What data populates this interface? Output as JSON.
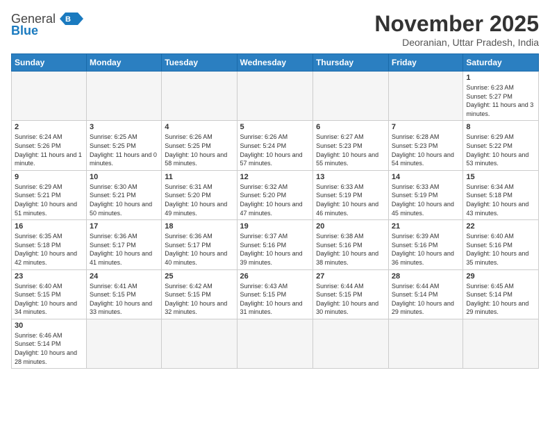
{
  "header": {
    "logo_general": "General",
    "logo_blue": "Blue",
    "month_title": "November 2025",
    "location": "Deoranian, Uttar Pradesh, India"
  },
  "weekdays": [
    "Sunday",
    "Monday",
    "Tuesday",
    "Wednesday",
    "Thursday",
    "Friday",
    "Saturday"
  ],
  "days": [
    {
      "date": "",
      "empty": true
    },
    {
      "date": "",
      "empty": true
    },
    {
      "date": "",
      "empty": true
    },
    {
      "date": "",
      "empty": true
    },
    {
      "date": "",
      "empty": true
    },
    {
      "date": "",
      "empty": true
    },
    {
      "date": "1",
      "sunrise": "Sunrise: 6:23 AM",
      "sunset": "Sunset: 5:27 PM",
      "daylight": "Daylight: 11 hours and 3 minutes."
    },
    {
      "date": "2",
      "sunrise": "Sunrise: 6:24 AM",
      "sunset": "Sunset: 5:26 PM",
      "daylight": "Daylight: 11 hours and 1 minute."
    },
    {
      "date": "3",
      "sunrise": "Sunrise: 6:25 AM",
      "sunset": "Sunset: 5:25 PM",
      "daylight": "Daylight: 11 hours and 0 minutes."
    },
    {
      "date": "4",
      "sunrise": "Sunrise: 6:26 AM",
      "sunset": "Sunset: 5:25 PM",
      "daylight": "Daylight: 10 hours and 58 minutes."
    },
    {
      "date": "5",
      "sunrise": "Sunrise: 6:26 AM",
      "sunset": "Sunset: 5:24 PM",
      "daylight": "Daylight: 10 hours and 57 minutes."
    },
    {
      "date": "6",
      "sunrise": "Sunrise: 6:27 AM",
      "sunset": "Sunset: 5:23 PM",
      "daylight": "Daylight: 10 hours and 55 minutes."
    },
    {
      "date": "7",
      "sunrise": "Sunrise: 6:28 AM",
      "sunset": "Sunset: 5:23 PM",
      "daylight": "Daylight: 10 hours and 54 minutes."
    },
    {
      "date": "8",
      "sunrise": "Sunrise: 6:29 AM",
      "sunset": "Sunset: 5:22 PM",
      "daylight": "Daylight: 10 hours and 53 minutes."
    },
    {
      "date": "9",
      "sunrise": "Sunrise: 6:29 AM",
      "sunset": "Sunset: 5:21 PM",
      "daylight": "Daylight: 10 hours and 51 minutes."
    },
    {
      "date": "10",
      "sunrise": "Sunrise: 6:30 AM",
      "sunset": "Sunset: 5:21 PM",
      "daylight": "Daylight: 10 hours and 50 minutes."
    },
    {
      "date": "11",
      "sunrise": "Sunrise: 6:31 AM",
      "sunset": "Sunset: 5:20 PM",
      "daylight": "Daylight: 10 hours and 49 minutes."
    },
    {
      "date": "12",
      "sunrise": "Sunrise: 6:32 AM",
      "sunset": "Sunset: 5:20 PM",
      "daylight": "Daylight: 10 hours and 47 minutes."
    },
    {
      "date": "13",
      "sunrise": "Sunrise: 6:33 AM",
      "sunset": "Sunset: 5:19 PM",
      "daylight": "Daylight: 10 hours and 46 minutes."
    },
    {
      "date": "14",
      "sunrise": "Sunrise: 6:33 AM",
      "sunset": "Sunset: 5:19 PM",
      "daylight": "Daylight: 10 hours and 45 minutes."
    },
    {
      "date": "15",
      "sunrise": "Sunrise: 6:34 AM",
      "sunset": "Sunset: 5:18 PM",
      "daylight": "Daylight: 10 hours and 43 minutes."
    },
    {
      "date": "16",
      "sunrise": "Sunrise: 6:35 AM",
      "sunset": "Sunset: 5:18 PM",
      "daylight": "Daylight: 10 hours and 42 minutes."
    },
    {
      "date": "17",
      "sunrise": "Sunrise: 6:36 AM",
      "sunset": "Sunset: 5:17 PM",
      "daylight": "Daylight: 10 hours and 41 minutes."
    },
    {
      "date": "18",
      "sunrise": "Sunrise: 6:36 AM",
      "sunset": "Sunset: 5:17 PM",
      "daylight": "Daylight: 10 hours and 40 minutes."
    },
    {
      "date": "19",
      "sunrise": "Sunrise: 6:37 AM",
      "sunset": "Sunset: 5:16 PM",
      "daylight": "Daylight: 10 hours and 39 minutes."
    },
    {
      "date": "20",
      "sunrise": "Sunrise: 6:38 AM",
      "sunset": "Sunset: 5:16 PM",
      "daylight": "Daylight: 10 hours and 38 minutes."
    },
    {
      "date": "21",
      "sunrise": "Sunrise: 6:39 AM",
      "sunset": "Sunset: 5:16 PM",
      "daylight": "Daylight: 10 hours and 36 minutes."
    },
    {
      "date": "22",
      "sunrise": "Sunrise: 6:40 AM",
      "sunset": "Sunset: 5:16 PM",
      "daylight": "Daylight: 10 hours and 35 minutes."
    },
    {
      "date": "23",
      "sunrise": "Sunrise: 6:40 AM",
      "sunset": "Sunset: 5:15 PM",
      "daylight": "Daylight: 10 hours and 34 minutes."
    },
    {
      "date": "24",
      "sunrise": "Sunrise: 6:41 AM",
      "sunset": "Sunset: 5:15 PM",
      "daylight": "Daylight: 10 hours and 33 minutes."
    },
    {
      "date": "25",
      "sunrise": "Sunrise: 6:42 AM",
      "sunset": "Sunset: 5:15 PM",
      "daylight": "Daylight: 10 hours and 32 minutes."
    },
    {
      "date": "26",
      "sunrise": "Sunrise: 6:43 AM",
      "sunset": "Sunset: 5:15 PM",
      "daylight": "Daylight: 10 hours and 31 minutes."
    },
    {
      "date": "27",
      "sunrise": "Sunrise: 6:44 AM",
      "sunset": "Sunset: 5:15 PM",
      "daylight": "Daylight: 10 hours and 30 minutes."
    },
    {
      "date": "28",
      "sunrise": "Sunrise: 6:44 AM",
      "sunset": "Sunset: 5:14 PM",
      "daylight": "Daylight: 10 hours and 29 minutes."
    },
    {
      "date": "29",
      "sunrise": "Sunrise: 6:45 AM",
      "sunset": "Sunset: 5:14 PM",
      "daylight": "Daylight: 10 hours and 29 minutes."
    },
    {
      "date": "30",
      "sunrise": "Sunrise: 6:46 AM",
      "sunset": "Sunset: 5:14 PM",
      "daylight": "Daylight: 10 hours and 28 minutes."
    }
  ]
}
